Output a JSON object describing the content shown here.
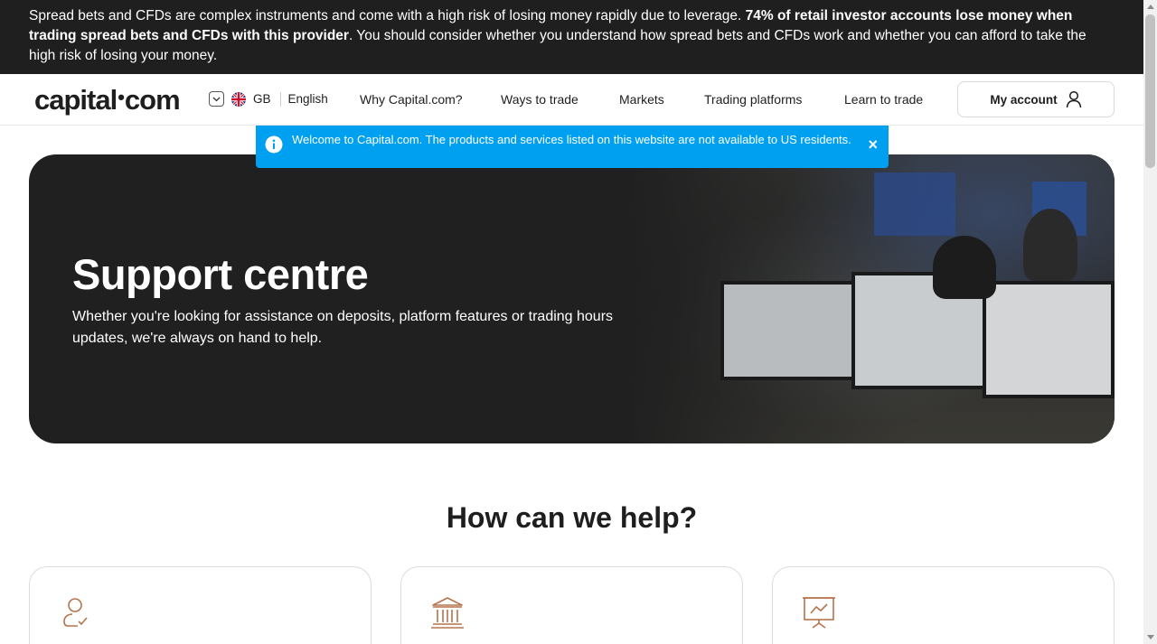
{
  "risk_banner": {
    "text_1": "Spread bets and CFDs are complex instruments and come with a high risk of losing money rapidly due to leverage. ",
    "text_bold": "74% of retail investor accounts lose money when trading spread bets and CFDs with this provider",
    "text_2": ". You should consider whether you understand how spread bets and CFDs work and whether you can afford to take the high risk of losing your money."
  },
  "header": {
    "logo_left": "capital",
    "logo_dot": "•",
    "logo_right": "com",
    "country": "GB",
    "language": "English",
    "nav": [
      "Why Capital.com?",
      "Ways to trade",
      "Markets",
      "Trading platforms",
      "Learn to trade"
    ],
    "account_label": "My account"
  },
  "notice": {
    "text": "Welcome to Capital.com. The products and services listed on this website are not available to US residents.",
    "close": "×"
  },
  "hero": {
    "title": "Support centre",
    "subtitle": "Whether you're looking for assistance on deposits, platform features or trading hours updates, we're always on hand to help."
  },
  "help": {
    "title": "How can we help?",
    "cards": [
      {
        "icon": "user-check-icon"
      },
      {
        "icon": "bank-icon"
      },
      {
        "icon": "presentation-chart-icon"
      }
    ]
  },
  "colors": {
    "banner_bg": "#1f1f1f",
    "notice_bg": "#00a0f0",
    "hero_bg": "#202020",
    "icon_accent": "#b5734b"
  }
}
